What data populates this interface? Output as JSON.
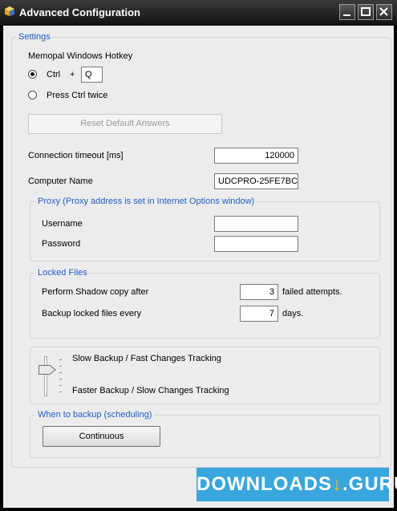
{
  "window": {
    "title": "Advanced Configuration"
  },
  "settings": {
    "legend": "Settings",
    "hotkey_label": "Memopal Windows Hotkey",
    "ctrl_label": "Ctrl",
    "plus": "+",
    "hotkey_key": "Q",
    "press_twice_label": "Press Ctrl twice",
    "selected_option": "Ctrl",
    "reset_button": "Reset Default Answers",
    "timeout_label": "Connection timeout [ms]",
    "timeout_value": "120000",
    "computer_label": "Computer Name",
    "computer_value": "UDCPRO-25FE7BC"
  },
  "proxy": {
    "legend": "Proxy (Proxy address is set in Internet Options window)",
    "username_label": "Username",
    "username_value": "",
    "password_label": "Password",
    "password_value": ""
  },
  "locked": {
    "legend": "Locked Files",
    "shadow_label": "Perform Shadow copy after",
    "shadow_value": "3",
    "shadow_suffix": "failed attempts.",
    "backup_label": "Backup locked files every",
    "backup_value": "7",
    "backup_suffix": "days."
  },
  "tracking": {
    "slow_label": "Slow Backup / Fast Changes Tracking",
    "fast_label": "Faster Backup / Slow Changes Tracking"
  },
  "schedule": {
    "legend": "When to backup (scheduling)",
    "button": "Continuous"
  },
  "watermark": {
    "text": "DOWNLOADS",
    "suffix": ".GURU",
    "arrow": "↓"
  },
  "colors": {
    "legend": "#1e5ec8",
    "watermark_bg": "#39a6dd",
    "client_bg": "#ececec"
  }
}
